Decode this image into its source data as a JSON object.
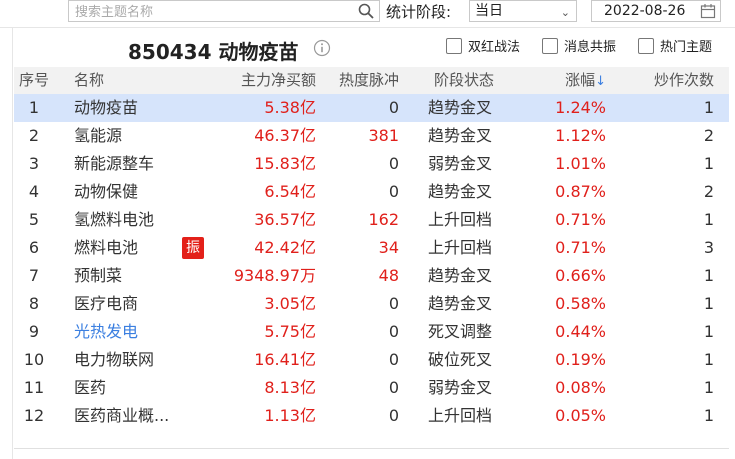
{
  "search": {
    "placeholder": "搜索主题名称"
  },
  "filter": {
    "label": "统计阶段:",
    "period": "当日",
    "date": "2022-08-26"
  },
  "title": "850434 动物疫苗",
  "options": [
    "双红战法",
    "消息共振",
    "热门主题"
  ],
  "columns": {
    "idx": "序号",
    "name": "名称",
    "amount": "主力净买额",
    "heat": "热度脉冲",
    "stage": "阶段状态",
    "change": "涨幅",
    "sort_indicator": "↓",
    "count": "炒作次数"
  },
  "rows": [
    {
      "idx": "1",
      "name": "动物疫苗",
      "amount": "5.38亿",
      "heat": "0",
      "stage": "趋势金叉",
      "change": "1.24%",
      "count": "1"
    },
    {
      "idx": "2",
      "name": "氢能源",
      "amount": "46.37亿",
      "heat": "381",
      "stage": "趋势金叉",
      "change": "1.12%",
      "count": "2"
    },
    {
      "idx": "3",
      "name": "新能源整车",
      "amount": "15.83亿",
      "heat": "0",
      "stage": "弱势金叉",
      "change": "1.01%",
      "count": "1"
    },
    {
      "idx": "4",
      "name": "动物保健",
      "amount": "6.54亿",
      "heat": "0",
      "stage": "趋势金叉",
      "change": "0.87%",
      "count": "2"
    },
    {
      "idx": "5",
      "name": "氢燃料电池",
      "amount": "36.57亿",
      "heat": "162",
      "stage": "上升回档",
      "change": "0.71%",
      "count": "1"
    },
    {
      "idx": "6",
      "name": "燃料电池",
      "badge": "振",
      "amount": "42.42亿",
      "heat": "34",
      "stage": "上升回档",
      "change": "0.71%",
      "count": "3"
    },
    {
      "idx": "7",
      "name": "预制菜",
      "amount": "9348.97万",
      "heat": "48",
      "stage": "趋势金叉",
      "change": "0.66%",
      "count": "1"
    },
    {
      "idx": "8",
      "name": "医疗电商",
      "amount": "3.05亿",
      "heat": "0",
      "stage": "趋势金叉",
      "change": "0.58%",
      "count": "1"
    },
    {
      "idx": "9",
      "name": "光热发电",
      "amount": "5.75亿",
      "heat": "0",
      "stage": "死叉调整",
      "change": "0.44%",
      "count": "1"
    },
    {
      "idx": "10",
      "name": "电力物联网",
      "amount": "16.41亿",
      "heat": "0",
      "stage": "破位死叉",
      "change": "0.19%",
      "count": "1"
    },
    {
      "idx": "11",
      "name": "医药",
      "amount": "8.13亿",
      "heat": "0",
      "stage": "弱势金叉",
      "change": "0.08%",
      "count": "1"
    },
    {
      "idx": "12",
      "name": "医药商业概...",
      "amount": "1.13亿",
      "heat": "0",
      "stage": "上升回档",
      "change": "0.05%",
      "count": "1"
    }
  ],
  "colors": {
    "up": "#e0201b",
    "selected_row": "#d6e4fb",
    "link": "#3b7fe0",
    "badge": "#e32019"
  }
}
